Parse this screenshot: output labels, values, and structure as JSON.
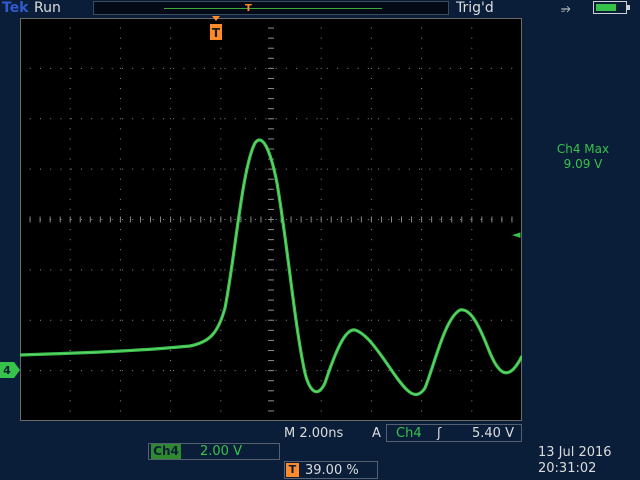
{
  "header": {
    "brand": "Tek",
    "status": "Run",
    "trigger_state": "Trig'd",
    "record_marker": "T"
  },
  "measurement": {
    "label": "Ch4 Max",
    "value": "9.09 V"
  },
  "markers": {
    "trigger_position": "T",
    "channel": "4",
    "trigger_level_arrow": "◄"
  },
  "readouts": {
    "timebase": "M 2.00ns",
    "acq_mode": "A",
    "trigger_source": "Ch4",
    "slope": "ʃ",
    "trigger_level": "5.40 V",
    "channel_badge": "Ch4",
    "channel_scale": "2.00 V",
    "trigger_badge": "T",
    "trigger_percent": "39.00 %"
  },
  "datetime": {
    "date": "13 Jul  2016",
    "time": "20:31:02"
  },
  "colors": {
    "trace": "#37c24a",
    "background": "#0a1e3a",
    "trigger": "#ff8a2a"
  },
  "icons": {
    "power": "plug-icon",
    "battery": "battery-icon"
  }
}
